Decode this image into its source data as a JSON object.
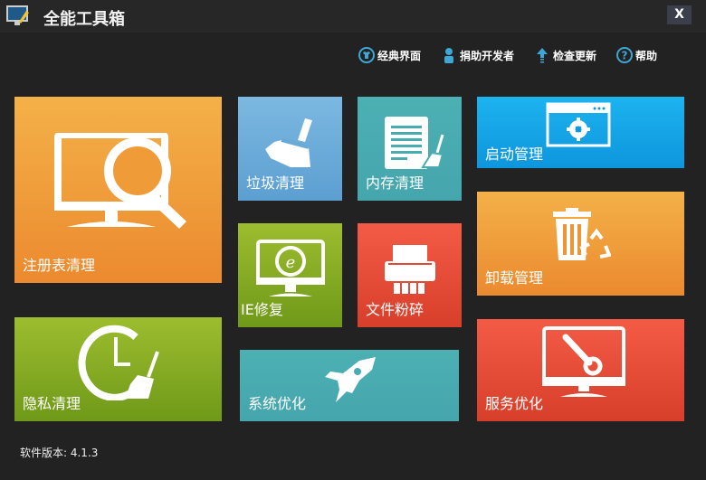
{
  "app": {
    "title": "全能工具箱",
    "close_label": "X",
    "version_text": "软件版本: 4.1.3"
  },
  "toplinks": [
    {
      "label": "经典界面",
      "icon": "shirt-icon"
    },
    {
      "label": "捐助开发者",
      "icon": "person-icon"
    },
    {
      "label": "检查更新",
      "icon": "arrow-up-icon"
    },
    {
      "label": "帮助",
      "icon": "help-icon"
    }
  ],
  "tiles": {
    "registry": "注册表清理",
    "junk": "垃圾清理",
    "memory": "内存清理",
    "startup": "启动管理",
    "ie": "IE修复",
    "shred": "文件粉碎",
    "uninstall": "卸载管理",
    "privacy": "隐私清理",
    "system": "系统优化",
    "service": "服务优化"
  },
  "colors": {
    "orange": "#eb8a2f",
    "blue": "#5c9fd1",
    "teal": "#45a6ad",
    "sky": "#0e96dd",
    "green": "#6f9919",
    "red": "#d83f2b",
    "link_icon": "#3fa7d6"
  }
}
